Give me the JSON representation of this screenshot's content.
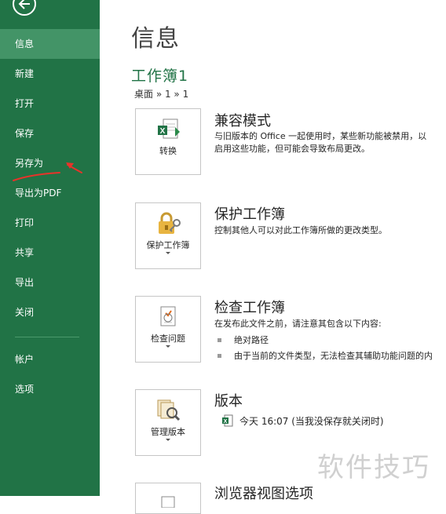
{
  "sidebar": {
    "items": [
      {
        "label": "信息"
      },
      {
        "label": "新建"
      },
      {
        "label": "打开"
      },
      {
        "label": "保存"
      },
      {
        "label": "另存为"
      },
      {
        "label": "导出为PDF"
      },
      {
        "label": "打印"
      },
      {
        "label": "共享"
      },
      {
        "label": "导出"
      },
      {
        "label": "关闭"
      },
      {
        "label": "帐户"
      },
      {
        "label": "选项"
      }
    ],
    "active_item": "信息"
  },
  "main": {
    "title": "信息",
    "workbook_name": "工作簿1",
    "breadcrumb": "桌面 » 1 » 1",
    "sections": [
      {
        "button_label": "转换",
        "title": "兼容模式",
        "desc_line1": "与旧版本的 Office 一起使用时，某些新功能被禁用，以",
        "desc_line2": "启用这些功能，但可能会导致布局更改。"
      },
      {
        "button_label": "保护工作簿",
        "title": "保护工作簿",
        "desc_line1": "控制其他人可以对此工作簿所做的更改类型。"
      },
      {
        "button_label": "检查问题",
        "title": "检查工作簿",
        "desc_line1": "在发布此文件之前，请注意其包含以下内容:",
        "bullets": [
          "绝对路径",
          "由于当前的文件类型，无法检查其辅助功能问题的内"
        ]
      },
      {
        "button_label": "管理版本",
        "title": "版本",
        "version_entry": "今天 16:07 (当我没保存就关闭时)"
      },
      {
        "title": "浏览器视图选项"
      }
    ]
  },
  "watermark": "软件技巧",
  "colors": {
    "sidebar_bg": "#217346",
    "sidebar_active": "#439467",
    "accent_green": "#217346",
    "annotation_red": "#e8332a"
  }
}
